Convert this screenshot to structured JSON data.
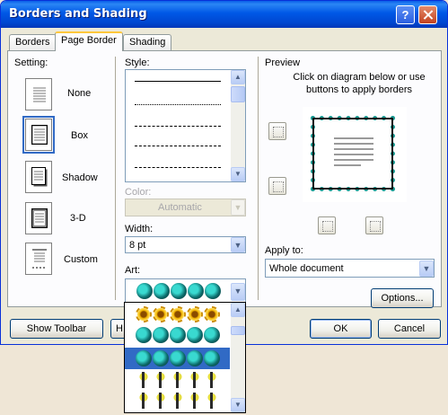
{
  "window": {
    "title": "Borders and Shading"
  },
  "titlebar": {
    "help_label": "?"
  },
  "tabs": [
    {
      "label": "Borders",
      "active": false
    },
    {
      "label": "Page Border",
      "active": true
    },
    {
      "label": "Shading",
      "active": false
    }
  ],
  "setting": {
    "label": "Setting:",
    "options": [
      {
        "label": "None",
        "selected": false
      },
      {
        "label": "Box",
        "selected": true
      },
      {
        "label": "Shadow",
        "selected": false
      },
      {
        "label": "3-D",
        "selected": false
      },
      {
        "label": "Custom",
        "selected": false
      }
    ]
  },
  "style": {
    "label": "Style:",
    "line_styles": [
      "solid",
      "dotted",
      "dashed",
      "dashed-long",
      "dash-dot"
    ]
  },
  "color": {
    "label": "Color:",
    "value": "Automatic",
    "disabled": true
  },
  "width": {
    "label": "Width:",
    "value": "8 pt"
  },
  "art": {
    "label": "Art:",
    "selected": "globe",
    "options": [
      "sun",
      "globe",
      "globe",
      "tree",
      "figure",
      "figure"
    ]
  },
  "preview": {
    "label": "Preview",
    "instructions": "Click on diagram below or use buttons to apply borders",
    "border_color": "#1b9a92"
  },
  "apply_to": {
    "label": "Apply to:",
    "value": "Whole document"
  },
  "buttons": {
    "options": "Options...",
    "show_toolbar": "Show Toolbar",
    "horizontal_line": "H",
    "ok": "OK",
    "cancel": "Cancel"
  },
  "colors": {
    "accent": "#0058e6",
    "tab_highlight": "#ffc83c",
    "selection": "#316ac5"
  }
}
